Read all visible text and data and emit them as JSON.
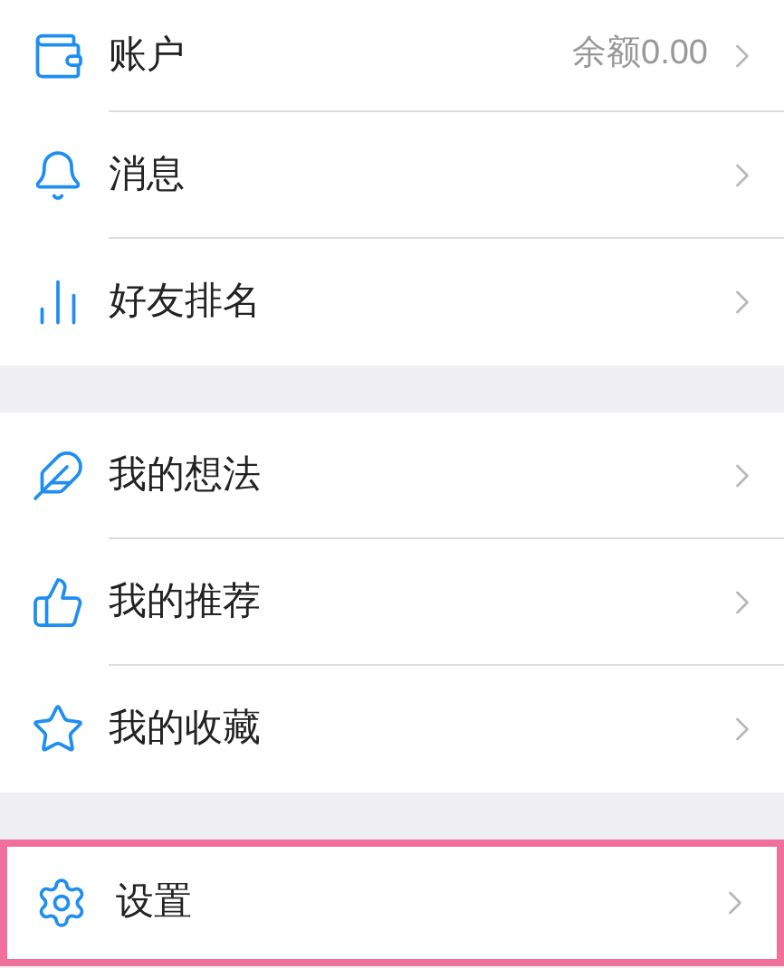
{
  "groups": [
    {
      "items": [
        {
          "kind": "wallet",
          "label": "账户",
          "value": "余额0.00",
          "highlighted": false
        },
        {
          "kind": "bell",
          "label": "消息",
          "highlighted": false
        },
        {
          "kind": "chart",
          "label": "好友排名",
          "highlighted": false
        }
      ]
    },
    {
      "items": [
        {
          "kind": "feather",
          "label": "我的想法",
          "highlighted": false
        },
        {
          "kind": "thumb",
          "label": "我的推荐",
          "highlighted": false
        },
        {
          "kind": "star",
          "label": "我的收藏",
          "highlighted": false
        }
      ]
    },
    {
      "items": [
        {
          "kind": "gear",
          "label": "设置",
          "highlighted": true
        }
      ]
    }
  ]
}
